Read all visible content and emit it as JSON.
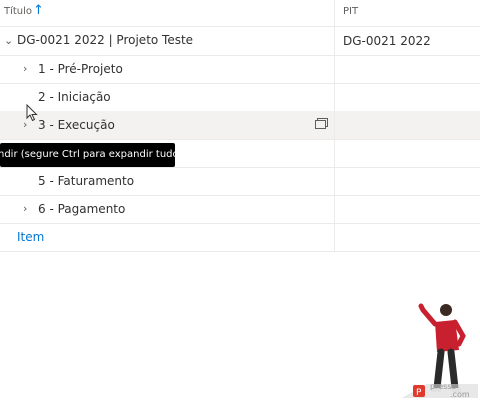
{
  "header": {
    "title_col": "Título",
    "sort_icon": "arrow-up-icon",
    "pit_col": "PIT"
  },
  "rows": [
    {
      "label": "DG-0021 2022 | Projeto Teste",
      "pit": "DG-0021 2022",
      "expanded": true
    },
    {
      "label": "1 - Pré-Projeto",
      "pit": ""
    },
    {
      "label": "2 - Iniciação",
      "pit": ""
    },
    {
      "label": "3 - Execução",
      "pit": "",
      "hover": true
    },
    {
      "label": "5 - Faturamento",
      "pit": ""
    },
    {
      "label": "6 - Pagamento",
      "pit": ""
    }
  ],
  "add_item": "Item",
  "tooltip": "ndir (segure Ctrl para expandir tudo)",
  "watermark": {
    "line1": "presso",
    "line2": ".com"
  }
}
